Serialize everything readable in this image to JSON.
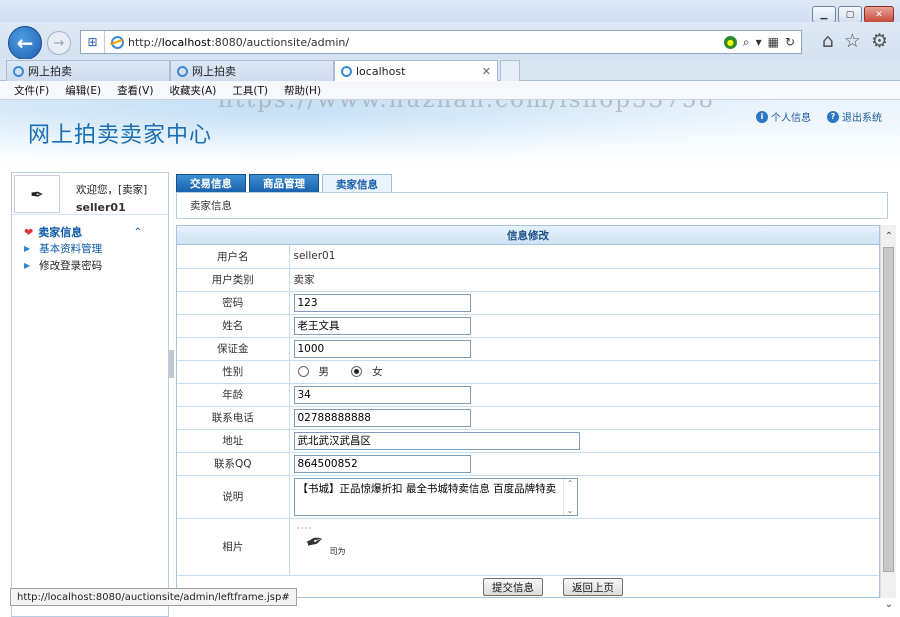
{
  "browser": {
    "url_prefix": "http://",
    "url_host": "localhost",
    "url_rest": ":8080/auctionsite/admin/",
    "tabs": [
      {
        "label": "网上拍卖"
      },
      {
        "label": "网上拍卖"
      },
      {
        "label": "localhost"
      }
    ],
    "menu": [
      "文件(F)",
      "编辑(E)",
      "查看(V)",
      "收藏夹(A)",
      "工具(T)",
      "帮助(H)"
    ],
    "status_url": "http://localhost:8080/auctionsite/admin/leftframe.jsp#"
  },
  "header": {
    "title": "网上拍卖卖家中心",
    "watermark": "https://www.huzhan.com/ishop33758",
    "links": [
      {
        "label": "个人信息",
        "icon": "info-icon"
      },
      {
        "label": "退出系统",
        "icon": "logout-icon"
      }
    ]
  },
  "sidebar": {
    "welcome": "欢迎您，[卖家]",
    "username": "seller01",
    "section": "卖家信息",
    "items": [
      {
        "label": "基本资料管理"
      },
      {
        "label": "修改登录密码"
      }
    ]
  },
  "main": {
    "tabs": [
      {
        "label": "交易信息"
      },
      {
        "label": "商品管理"
      },
      {
        "label": "卖家信息"
      }
    ],
    "sub_title": "卖家信息",
    "form_title": "信息修改",
    "fields": {
      "username_label": "用户名",
      "username_value": "seller01",
      "usertype_label": "用户类别",
      "usertype_value": "卖家",
      "password_label": "密码",
      "password_value": "123",
      "name_label": "姓名",
      "name_value": "老王文具",
      "deposit_label": "保证金",
      "deposit_value": "1000",
      "gender_label": "性别",
      "gender_male": "男",
      "gender_female": "女",
      "gender_selected": "女",
      "age_label": "年龄",
      "age_value": "34",
      "phone_label": "联系电话",
      "phone_value": "02788888888",
      "address_label": "地址",
      "address_value": "武北武汉武昌区",
      "qq_label": "联系QQ",
      "qq_value": "864500852",
      "desc_label": "说明",
      "desc_value": "【书城】正品惊爆折扣 最全书城特卖信息 百度品牌特卖",
      "photo_label": "相片",
      "photo_caption": "司为"
    },
    "buttons": {
      "submit": "提交信息",
      "back": "返回上页"
    }
  }
}
